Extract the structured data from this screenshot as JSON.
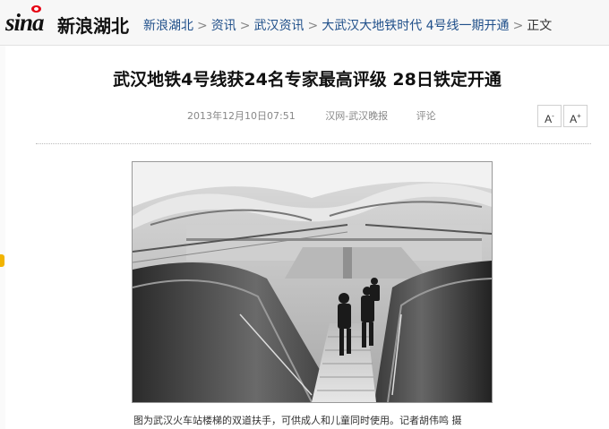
{
  "header": {
    "logo_text": "新浪湖北",
    "logo_mark": "sina",
    "breadcrumbs": [
      "新浪湖北",
      "资讯",
      "武汉资讯",
      "大武汉大地铁时代 4号线一期开通"
    ],
    "breadcrumb_current": "正文",
    "separator": ">"
  },
  "article": {
    "title": "武汉地铁4号线获24名专家最高评级 28日铁定开通",
    "datetime": "2013年12月10日07:51",
    "source": "汉网-武汉晚报",
    "comment_label": "评论",
    "font_decrease": "A",
    "font_decrease_sign": "-",
    "font_increase": "A",
    "font_increase_sign": "+",
    "photo_caption": "图为武汉火车站楼梯的双道扶手，可供成人和儿童同时使用。记者胡伟鸣 摄"
  },
  "colors": {
    "brand_red": "#e60012",
    "link_blue": "#1f4f8a"
  }
}
